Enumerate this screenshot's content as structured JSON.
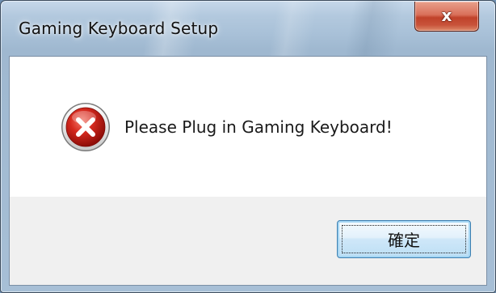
{
  "window": {
    "title": "Gaming Keyboard Setup",
    "close_glyph": "x"
  },
  "dialog": {
    "icon": "error-icon",
    "message": "Please Plug in Gaming Keyboard!",
    "ok_label": "確定"
  },
  "colors": {
    "error_red": "#c8201a",
    "close_button_red": "#c8533a",
    "button_border_blue": "#3c7fb1"
  }
}
